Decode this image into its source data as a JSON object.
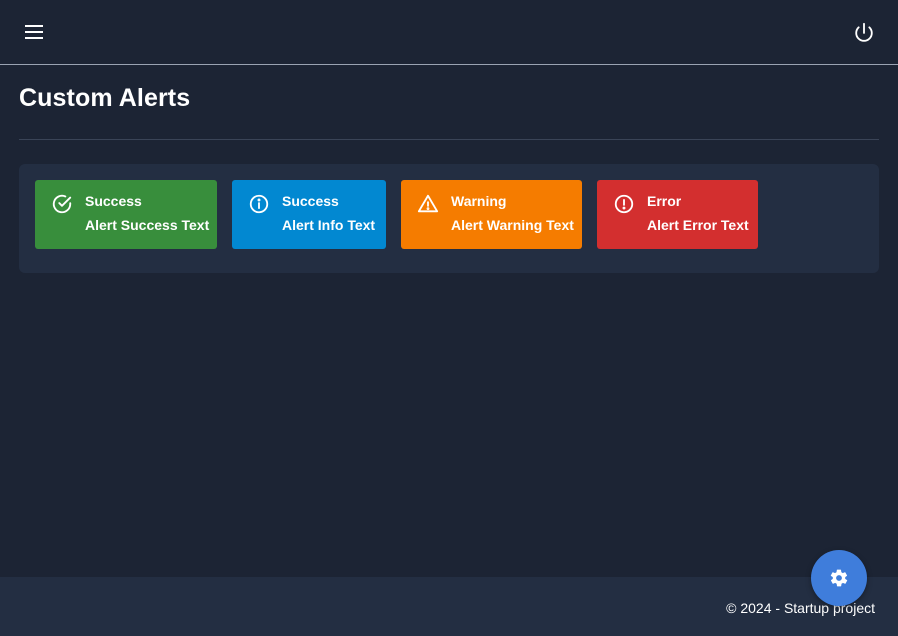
{
  "header": {
    "menu_icon": "hamburger-menu-icon",
    "power_icon": "power-icon"
  },
  "page": {
    "title": "Custom Alerts"
  },
  "alerts": [
    {
      "type": "success",
      "icon": "check-circle-icon",
      "title": "Success",
      "text": "Alert Success Text",
      "color": "#388e3c"
    },
    {
      "type": "info",
      "icon": "info-circle-icon",
      "title": "Success",
      "text": "Alert Info Text",
      "color": "#0288d1"
    },
    {
      "type": "warning",
      "icon": "warning-triangle-icon",
      "title": "Warning",
      "text": "Alert Warning Text",
      "color": "#f57c00"
    },
    {
      "type": "error",
      "icon": "error-circle-icon",
      "title": "Error",
      "text": "Alert Error Text",
      "color": "#d32f2f"
    }
  ],
  "footer": {
    "text": "© 2024 - Startup project"
  },
  "fab": {
    "icon": "gear-icon",
    "color": "#3f7ddb"
  },
  "theme": {
    "background": "#1c2434",
    "panel": "#232e42"
  }
}
